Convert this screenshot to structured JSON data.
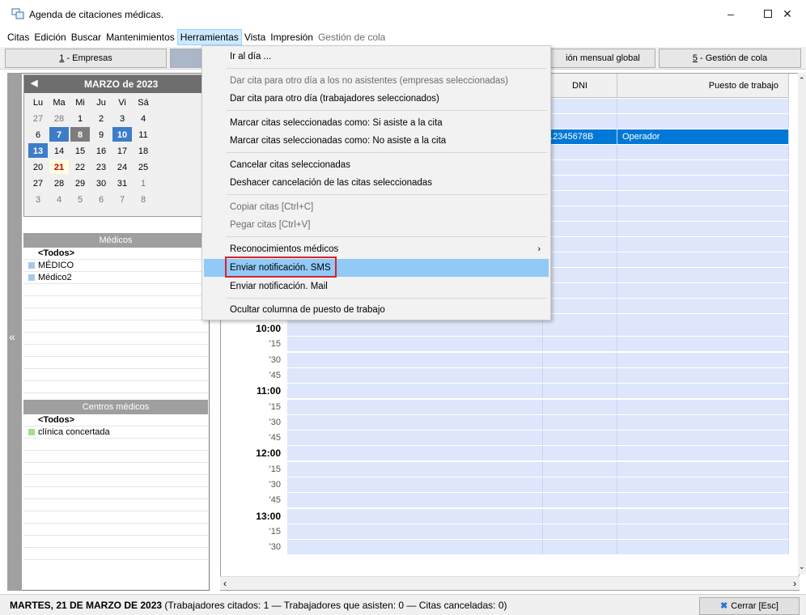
{
  "window": {
    "title": "Agenda de citaciones médicas.",
    "minimize_icon": "minimize-icon",
    "maximize_icon": "maximize-icon",
    "close_icon": "close-icon"
  },
  "menubar": {
    "items": [
      {
        "label": "Citas",
        "state": "normal"
      },
      {
        "label": "Edición",
        "state": "normal"
      },
      {
        "label": "Buscar",
        "state": "normal"
      },
      {
        "label": "Mantenimientos",
        "state": "normal"
      },
      {
        "label": "Herramientas",
        "state": "active"
      },
      {
        "label": "Vista",
        "state": "normal"
      },
      {
        "label": "Impresión",
        "state": "normal"
      },
      {
        "label": "Gestión de cola",
        "state": "disabled"
      }
    ]
  },
  "tabs": {
    "t1": {
      "key": "1",
      "label": " - Empresas"
    },
    "t4": {
      "label": "ión mensual global"
    },
    "t5": {
      "key": "5",
      "label": " - Gestión de cola"
    }
  },
  "calendar": {
    "month_label": "MARZO de 2023",
    "prev_icon": "chevron-left-icon",
    "weekdays": [
      "Lu",
      "Ma",
      "Mi",
      "Ju",
      "Vi",
      "Sá"
    ],
    "weeks": [
      [
        "27",
        "28",
        "1",
        "2",
        "3",
        "4"
      ],
      [
        "6",
        "7",
        "8",
        "9",
        "10",
        "11"
      ],
      [
        "13",
        "14",
        "15",
        "16",
        "17",
        "18"
      ],
      [
        "20",
        "21",
        "22",
        "23",
        "24",
        "25"
      ],
      [
        "27",
        "28",
        "29",
        "30",
        "31",
        "1"
      ],
      [
        "3",
        "4",
        "5",
        "6",
        "7",
        "8"
      ]
    ]
  },
  "medicos": {
    "header": "Médicos",
    "items": [
      "<Todos>",
      "MÉDICO",
      "Médico2"
    ]
  },
  "centros": {
    "header": "Centros médicos",
    "items": [
      "<Todos>",
      "clínica concertada"
    ]
  },
  "grid": {
    "columns": {
      "dni": "DNI",
      "puesto": "Puesto de trabajo"
    },
    "selected_row": {
      "dni": "12345678B",
      "puesto": "Operador"
    },
    "times": [
      "10:00",
      "'15",
      "'30",
      "'45",
      "11:00",
      "'15",
      "'30",
      "'45",
      "12:00",
      "'15",
      "'30",
      "'45",
      "13:00",
      "'15",
      "'30"
    ]
  },
  "dropdown": {
    "items": [
      {
        "label": "Ir al día ...",
        "state": "normal"
      },
      {
        "label": "Dar cita para otro día a los no asistentes (empresas seleccionadas)",
        "state": "disabled"
      },
      {
        "label": "Dar cita para otro día (trabajadores seleccionados)",
        "state": "normal"
      },
      {
        "label": "Marcar citas seleccionadas como: Si asiste a la cita",
        "state": "normal"
      },
      {
        "label": "Marcar citas seleccionadas como: No asiste a la cita",
        "state": "normal"
      },
      {
        "label": "Cancelar citas seleccionadas",
        "state": "normal"
      },
      {
        "label": "Deshacer cancelación de las citas seleccionadas",
        "state": "normal"
      },
      {
        "label": "Copiar citas  [Ctrl+C]",
        "state": "disabled"
      },
      {
        "label": "Pegar citas  [Ctrl+V]",
        "state": "disabled"
      },
      {
        "label": "Reconocimientos médicos",
        "state": "normal"
      },
      {
        "label": "Enviar notificación. SMS",
        "state": "hover"
      },
      {
        "label": "Enviar notificación. Mail",
        "state": "normal"
      },
      {
        "label": "Ocultar columna de puesto de trabajo",
        "state": "normal"
      }
    ]
  },
  "status": {
    "date": "MARTES, 21 DE MARZO DE 2023",
    "summary": "(Trabajadores citados: 1  —  Trabajadores que asisten: 0  —  Citas canceladas: 0)",
    "close_label": "Cerrar [Esc]"
  }
}
